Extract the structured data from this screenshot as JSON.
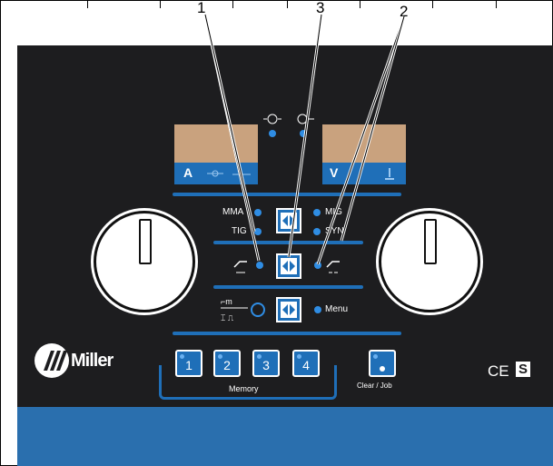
{
  "callouts": [
    "1",
    "3",
    "2"
  ],
  "displays": {
    "left_letter": "A",
    "right_letter": "V"
  },
  "process": {
    "mma": "MMA",
    "tig": "TIG",
    "mig": "MIG",
    "syn": "SYN"
  },
  "menu_label": "Menu",
  "brand": "Miller",
  "memory": {
    "buttons": [
      "1",
      "2",
      "3",
      "4"
    ],
    "label": "Memory"
  },
  "clear_job_label": "Clear / Job",
  "marks": {
    "ce": "CE",
    "s": "S"
  },
  "colors": {
    "panel": "#1d1d1f",
    "accent_blue": "#1f6fb8",
    "display_amber": "#c9a27e",
    "led_blue": "#2f8de4"
  },
  "icons": [
    "arc-force-icon",
    "inductance-icon",
    "voltage-icon",
    "wire-feed-icon",
    "torch-trigger-icon",
    "gas-purge-icon",
    "selector-arrows-icon"
  ]
}
